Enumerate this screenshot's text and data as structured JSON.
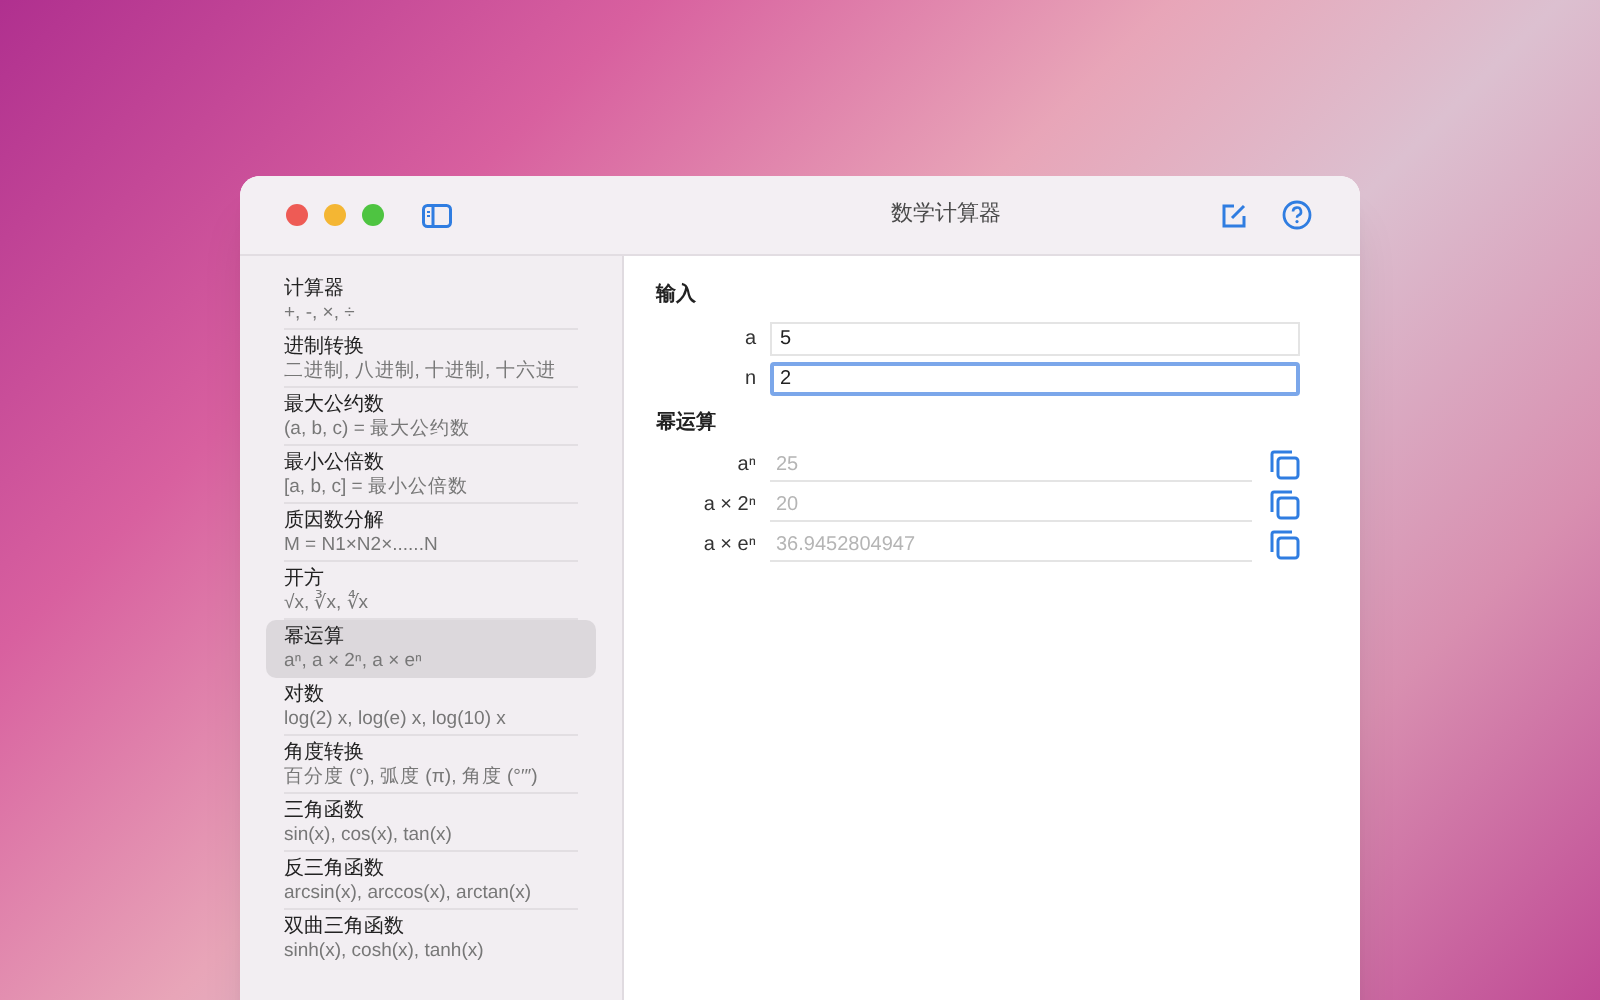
{
  "window": {
    "title": "数学计算器"
  },
  "sidebar": {
    "items": [
      {
        "title": "计算器",
        "subtitle": "+, -, ×, ÷",
        "selected": false
      },
      {
        "title": "进制转换",
        "subtitle": "二进制, 八进制, 十进制, 十六进",
        "selected": false
      },
      {
        "title": "最大公约数",
        "subtitle": "(a, b, c) = 最大公约数",
        "selected": false
      },
      {
        "title": "最小公倍数",
        "subtitle": "[a, b, c] = 最小公倍数",
        "selected": false
      },
      {
        "title": "质因数分解",
        "subtitle": "M = N1×N2×......N",
        "selected": false
      },
      {
        "title": "开方",
        "subtitle": "√x, ∛x, ∜x",
        "selected": false
      },
      {
        "title": "幂运算",
        "subtitle": "aⁿ, a × 2ⁿ, a × eⁿ",
        "selected": true
      },
      {
        "title": "对数",
        "subtitle": "log(2) x, log(e) x, log(10) x",
        "selected": false
      },
      {
        "title": "角度转换",
        "subtitle": "百分度 (°), 弧度 (π), 角度 (°′″)",
        "selected": false
      },
      {
        "title": "三角函数",
        "subtitle": "sin(x), cos(x), tan(x)",
        "selected": false
      },
      {
        "title": "反三角函数",
        "subtitle": "arcsin(x), arccos(x), arctan(x)",
        "selected": false
      },
      {
        "title": "双曲三角函数",
        "subtitle": "sinh(x), cosh(x), tanh(x)",
        "selected": false
      }
    ]
  },
  "input": {
    "heading": "输入",
    "fields": [
      {
        "label": "a",
        "value": "5",
        "focused": false
      },
      {
        "label": "n",
        "value": "2",
        "focused": true
      }
    ]
  },
  "results": {
    "heading": "幂运算",
    "rows": [
      {
        "label": "aⁿ",
        "placeholder": "25"
      },
      {
        "label": "a × 2ⁿ",
        "placeholder": "20"
      },
      {
        "label": "a × eⁿ",
        "placeholder": "36.9452804947"
      }
    ]
  }
}
